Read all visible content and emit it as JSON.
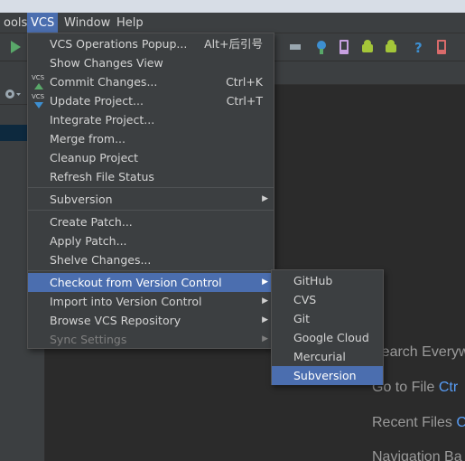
{
  "menubar": {
    "items": [
      {
        "label": "ools"
      },
      {
        "label": "VCS"
      },
      {
        "label": "Window"
      },
      {
        "label": "Help"
      }
    ]
  },
  "vcs_menu": {
    "items": [
      {
        "label": "VCS Operations Popup...",
        "shortcut": "Alt+后引号"
      },
      {
        "label": "Show Changes View"
      },
      {
        "label": "Commit Changes...",
        "shortcut": "Ctrl+K",
        "icon": "vcs-commit-icon"
      },
      {
        "label": "Update Project...",
        "shortcut": "Ctrl+T",
        "icon": "vcs-update-icon"
      },
      {
        "label": "Integrate Project..."
      },
      {
        "label": "Merge from..."
      },
      {
        "label": "Cleanup Project"
      },
      {
        "label": "Refresh File Status"
      },
      {
        "label": "Subversion"
      },
      {
        "label": "Create Patch..."
      },
      {
        "label": "Apply Patch..."
      },
      {
        "label": "Shelve Changes..."
      },
      {
        "label": "Checkout from Version Control"
      },
      {
        "label": "Import into Version Control"
      },
      {
        "label": "Browse VCS Repository"
      },
      {
        "label": "Sync Settings"
      }
    ],
    "icon_text": "VCS"
  },
  "checkout_submenu": {
    "items": [
      {
        "label": "GitHub"
      },
      {
        "label": "CVS"
      },
      {
        "label": "Git"
      },
      {
        "label": "Google Cloud"
      },
      {
        "label": "Mercurial"
      },
      {
        "label": "Subversion"
      }
    ]
  },
  "editor_hints": [
    {
      "label": "Search Everyw",
      "prefix": "S"
    },
    {
      "label": "Go to File",
      "shortcut": "Ctr"
    },
    {
      "label": "Recent Files",
      "shortcut": "C"
    },
    {
      "label": "Navigation Ba"
    }
  ],
  "colors": {
    "menu_bg": "#3c3f41",
    "selection": "#4b6eaf",
    "editor_bg": "#2b2b2b",
    "shortcut_link": "#589df6"
  }
}
